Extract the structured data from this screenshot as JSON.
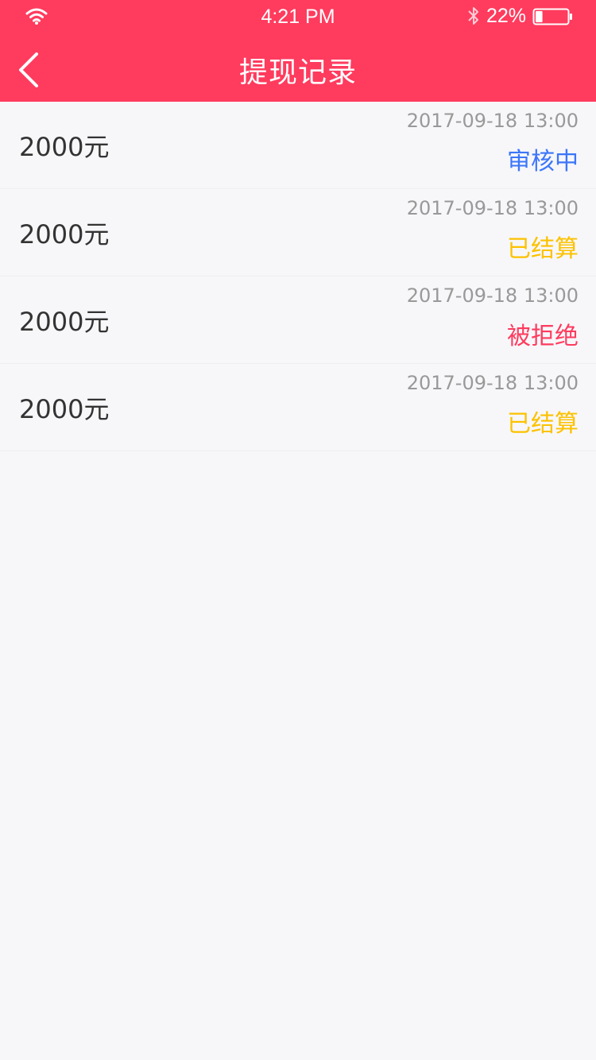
{
  "status_bar": {
    "time": "4:21 PM",
    "battery": "22%",
    "battery_level": 0.22,
    "icons": [
      "wifi-icon",
      "bluetooth-icon",
      "battery-icon"
    ]
  },
  "header": {
    "title": "提现记录",
    "back_icon": "chevron-left-icon",
    "background": "#ff3b5e"
  },
  "records": [
    {
      "amount": "2000元",
      "date": "2017-09-18 13:00",
      "status": "审核中",
      "status_color": "#3C76F9"
    },
    {
      "amount": "2000元",
      "date": "2017-09-18 13:00",
      "status": "已结算",
      "status_color": "#FCC200"
    },
    {
      "amount": "2000元",
      "date": "2017-09-18 13:00",
      "status": "被拒绝",
      "status_color": "#FF3B5E"
    },
    {
      "amount": "2000元",
      "date": "2017-09-18 13:00",
      "status": "已结算",
      "status_color": "#FCC200"
    }
  ],
  "colors": {
    "amount_text": "#333333",
    "date_text": "#999999",
    "divider": "#eeeeee",
    "page_background": "#f7f7fa"
  }
}
